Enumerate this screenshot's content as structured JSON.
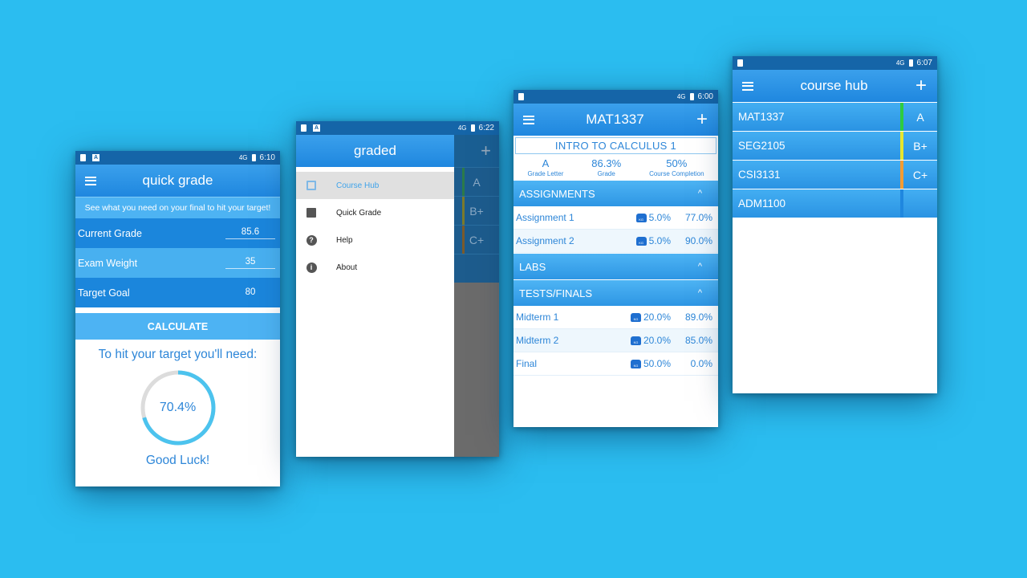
{
  "colors": {
    "background": "#2bbdf0",
    "primary": "#1f87df",
    "accent_text": "#2d86d8",
    "grade_a": "#2ecc40",
    "grade_bplus": "#e6e62e",
    "grade_cplus": "#f39c33",
    "grade_none": "#1f87df"
  },
  "quick_grade": {
    "status": {
      "time": "6:10",
      "network": "4G"
    },
    "title": "quick grade",
    "banner": "See what you need on your final to hit your target!",
    "fields": [
      {
        "label": "Current Grade",
        "value": "85.6"
      },
      {
        "label": "Exam Weight",
        "value": "35"
      },
      {
        "label": "Target Goal",
        "value": "80"
      }
    ],
    "calculate_label": "CALCULATE",
    "result_label": "To hit your target you'll need:",
    "result_percent": "70.4%",
    "result_fraction": 0.704,
    "good_luck": "Good Luck!"
  },
  "drawer": {
    "status": {
      "time": "6:22",
      "network": "4G"
    },
    "title": "graded",
    "items": [
      {
        "label": "Course Hub",
        "icon": "list-icon"
      },
      {
        "label": "Quick Grade",
        "icon": "bar-chart-icon"
      },
      {
        "label": "Help",
        "icon": "help-icon"
      },
      {
        "label": "About",
        "icon": "info-icon"
      }
    ],
    "behind_grades": [
      "A",
      "B+",
      "C+"
    ],
    "behind_plus": "+"
  },
  "course": {
    "status": {
      "time": "6:00",
      "network": "4G"
    },
    "title": "MAT1337",
    "name": "INTRO TO CALCULUS 1",
    "stats": [
      {
        "value": "A",
        "label": "Grade Letter"
      },
      {
        "value": "86.3%",
        "label": "Grade"
      },
      {
        "value": "50%",
        "label": "Course Completion"
      }
    ],
    "sections": [
      {
        "name": "ASSIGNMENTS",
        "rows": [
          {
            "name": "Assignment 1",
            "weight": "5.0%",
            "grade": "77.0%"
          },
          {
            "name": "Assignment 2",
            "weight": "5.0%",
            "grade": "90.0%"
          }
        ]
      },
      {
        "name": "LABS",
        "rows": []
      },
      {
        "name": "TESTS/FINALS",
        "rows": [
          {
            "name": "Midterm 1",
            "weight": "20.0%",
            "grade": "89.0%"
          },
          {
            "name": "Midterm 2",
            "weight": "20.0%",
            "grade": "85.0%"
          },
          {
            "name": "Final",
            "weight": "50.0%",
            "grade": "0.0%"
          }
        ]
      }
    ],
    "weight_icon_text": "KG"
  },
  "course_hub": {
    "status": {
      "time": "6:07",
      "network": "4G"
    },
    "title": "course hub",
    "courses": [
      {
        "code": "MAT1337",
        "grade": "A",
        "color": "#2ecc40"
      },
      {
        "code": "SEG2105",
        "grade": "B+",
        "color": "#e6e62e"
      },
      {
        "code": "CSI3131",
        "grade": "C+",
        "color": "#f39c33"
      },
      {
        "code": "ADM1100",
        "grade": "",
        "color": "#1f87df"
      }
    ]
  }
}
